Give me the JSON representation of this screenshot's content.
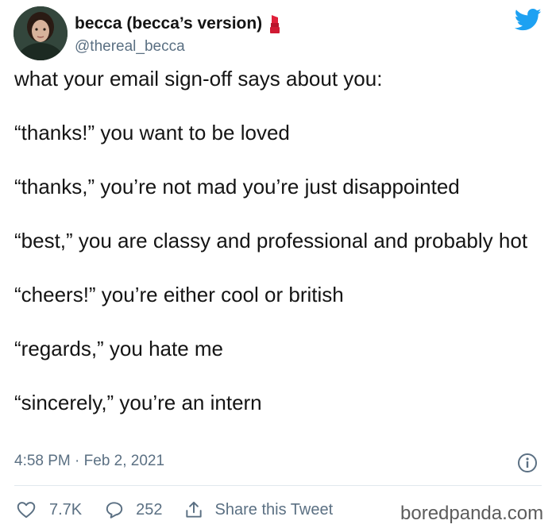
{
  "author": {
    "display_name": "becca (becca’s version)",
    "handle": "@thereal_becca",
    "avatar_icon": "profile-photo",
    "badge_icon": "lipstick-icon",
    "platform_icon": "twitter-bird-icon",
    "brand_color": "#1da1f2"
  },
  "tweet": {
    "lines": [
      "what your email sign-off says about you:",
      "“thanks!” you want to be loved",
      "“thanks,” you’re not mad you’re just disappointed",
      "“best,” you are classy and professional and probably hot",
      "“cheers!” you’re either cool or british",
      "“regards,” you hate me",
      "“sincerely,” you’re an intern"
    ],
    "timestamp": "4:58 PM · Feb 2, 2021"
  },
  "actions": {
    "like_count": "7.7K",
    "reply_count": "252",
    "share_label": "Share this Tweet"
  },
  "watermark": "boredpanda.com"
}
